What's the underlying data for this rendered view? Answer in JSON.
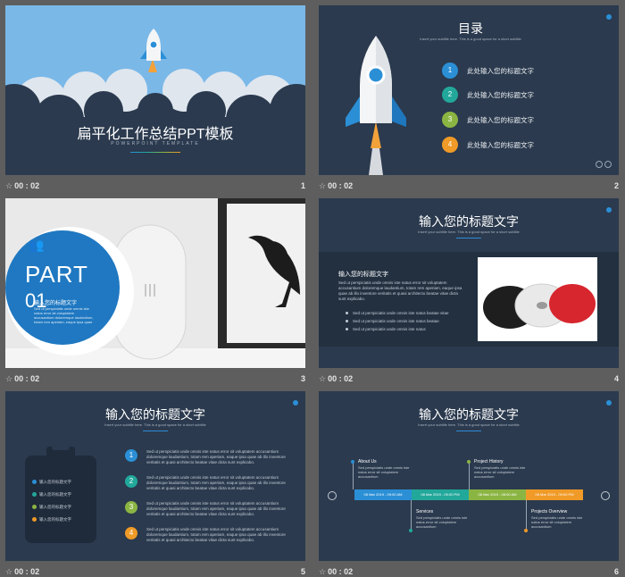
{
  "slides": [
    {
      "time": "00 : 02",
      "num": "1",
      "title": "扁平化工作总结PPT模板",
      "subtitle": "POWERPOINT TEMPLATE"
    },
    {
      "time": "00 : 02",
      "num": "2",
      "title": "目录",
      "subtitle": "Insert your subtitle here. This is a good space for a short subtitle",
      "items": [
        {
          "n": "1",
          "label": "此处输入您的标题文字",
          "color": "#2b8fd6"
        },
        {
          "n": "2",
          "label": "此处输入您的标题文字",
          "color": "#22a89b"
        },
        {
          "n": "3",
          "label": "此处输入您的标题文字",
          "color": "#8bb543"
        },
        {
          "n": "4",
          "label": "此处输入您的标题文字",
          "color": "#f09a27"
        }
      ]
    },
    {
      "time": "00 : 02",
      "num": "3",
      "part": "PART",
      "part_no": "01",
      "cn": "输入您的标题文字",
      "body": "Sed ut perspiciatis unde omnis iste natus error sit voluptatem accusantium doloremque laudantium, totam rem aperiam, eaque ipsa quae ab illo inventore"
    },
    {
      "time": "00 : 02",
      "num": "4",
      "title": "输入您的标题文字",
      "subtitle": "Insert your subtitle here. This is a good space for a short subtitle",
      "heading": "输入您的标题文字",
      "para": "Sed ut perspiciatis unde omnis iste natus error sit voluptatem accusantium doloremque laudantium, totam rem aperiam, eaque ipsa quae ab illo inventore veritatis et quasi architecto beatae vitae dicta sunt explicabo.",
      "bullets": [
        "Sed ut perspiciatis unde omnis iste natus beatae vitae",
        "Sed ut perspiciatis unde omnis iste natus beatae",
        "Sed ut perspiciatis unde omnis iste natus"
      ]
    },
    {
      "time": "00 : 02",
      "num": "5",
      "title": "输入您的标题文字",
      "subtitle": "Insert your subtitle here. This is a good space for a short subtitle",
      "checks": [
        "输入您的标题文字",
        "输入您的标题文字",
        "输入您的标题文字",
        "输入您的标题文字"
      ],
      "check_colors": [
        "#2b8fd6",
        "#22a89b",
        "#8bb543",
        "#f09a27"
      ],
      "rows": [
        "Sed ut perspiciatis unde omnis iste natus error sit voluptatem accusantium doloremque laudantium, totam rem aperiam, eaque ipsa quae ab illo inventore veritatis et quasi architecto beatae vitae dicta sunt explicabo.",
        "Sed ut perspiciatis unde omnis iste natus error sit voluptatem accusantium doloremque laudantium, totam rem aperiam, eaque ipsa quae ab illo inventore veritatis et quasi architecto beatae vitae dicta sunt explicabo.",
        "Sed ut perspiciatis unde omnis iste natus error sit voluptatem accusantium doloremque laudantium, totam rem aperiam, eaque ipsa quae ab illo inventore veritatis et quasi architecto beatae vitae dicta sunt explicabo.",
        "Sed ut perspiciatis unde omnis iste natus error sit voluptatem accusantium doloremque laudantium, totam rem aperiam, eaque ipsa quae ab illo inventore veritatis et quasi architecto beatae vitae dicta sunt explicabo."
      ]
    },
    {
      "time": "00 : 02",
      "num": "6",
      "title": "输入您的标题文字",
      "subtitle": "Insert your subtitle here. This is a good space for a short subtitle",
      "dates": [
        "08 Mar 2019 - 09:00 AM",
        "08 Mar 2019 - 09:00 PM",
        "08 Mar 2019 - 08:00 AM",
        "08 Mar 2019 - 09:00 PM"
      ],
      "date_colors": [
        "#2b8fd6",
        "#22a89b",
        "#8bb543",
        "#f09a27"
      ],
      "events": [
        {
          "t": "About Us",
          "d": "Sed perspiciatis unde omnis iste natus error sit voluptatem accusantium"
        },
        {
          "t": "Project History",
          "d": "Sed perspiciatis unde omnis iste natus error sit voluptatem accusantium"
        },
        {
          "t": "Services",
          "d": "Sed perspiciatis unde omnis iste natus error sit voluptatem accusantium"
        },
        {
          "t": "Projects Overview",
          "d": "Sed perspiciatis unde omnis iste natus error sit voluptatem accusantium"
        }
      ]
    }
  ]
}
